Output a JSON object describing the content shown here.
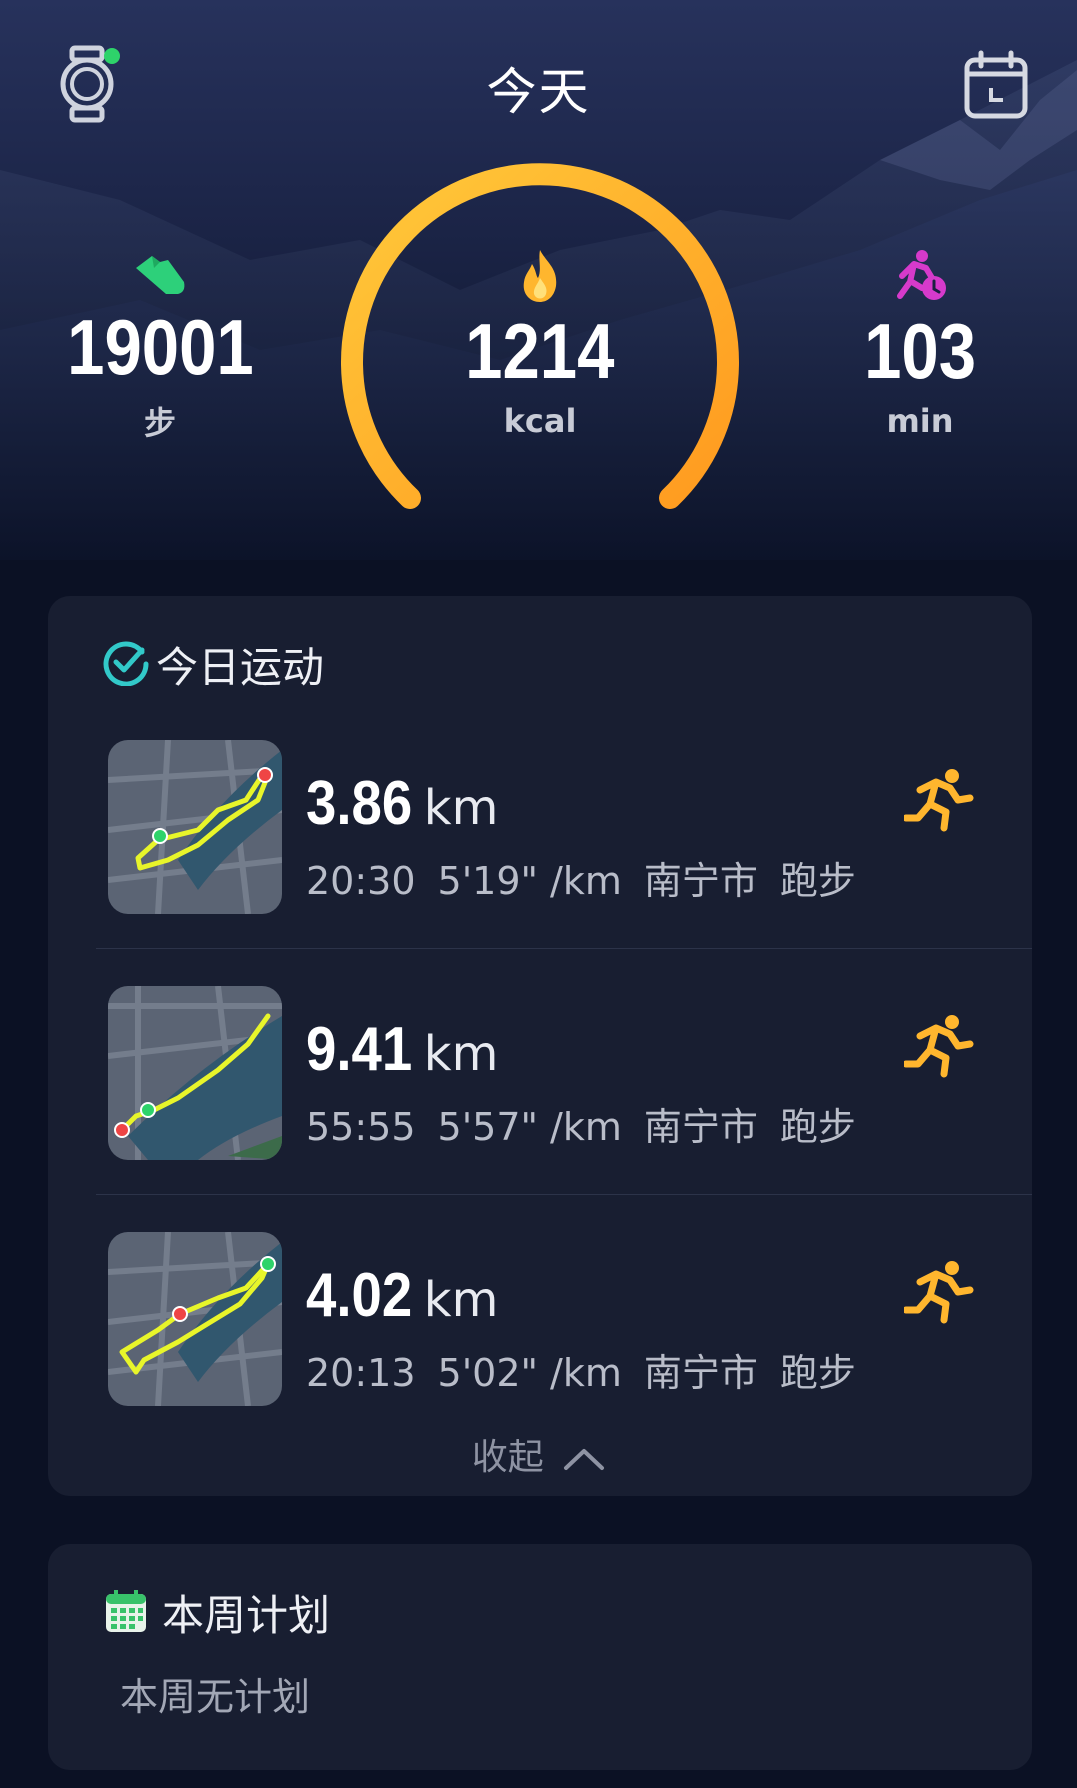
{
  "header": {
    "title": "今天",
    "watch_icon": "watch-icon",
    "calendar_icon": "calendar-icon"
  },
  "metrics": {
    "steps": {
      "value": "19001",
      "unit": "步",
      "icon": "shoe-icon",
      "color": "#2dd07a"
    },
    "calories": {
      "value": "1214",
      "unit": "kcal",
      "icon": "flame-icon",
      "color": "#ffb62e",
      "ring_progress": 1.0
    },
    "active": {
      "value": "103",
      "unit": "min",
      "icon": "running-clock-icon",
      "color": "#d63acb"
    }
  },
  "today_activities": {
    "title": "今日运动",
    "items": [
      {
        "distance": "3.86",
        "unit": "km",
        "duration": "20:30",
        "pace": "5'19\" /km",
        "city": "南宁市",
        "type": "跑步"
      },
      {
        "distance": "9.41",
        "unit": "km",
        "duration": "55:55",
        "pace": "5'57\" /km",
        "city": "南宁市",
        "type": "跑步"
      },
      {
        "distance": "4.02",
        "unit": "km",
        "duration": "20:13",
        "pace": "5'02\" /km",
        "city": "南宁市",
        "type": "跑步"
      }
    ],
    "collapse_label": "收起"
  },
  "weekly_plan": {
    "title": "本周计划",
    "empty_text": "本周无计划"
  },
  "colors": {
    "accent_orange": "#ffa726",
    "route_yellow": "#e8f52a",
    "check_teal": "#32c9c9"
  }
}
